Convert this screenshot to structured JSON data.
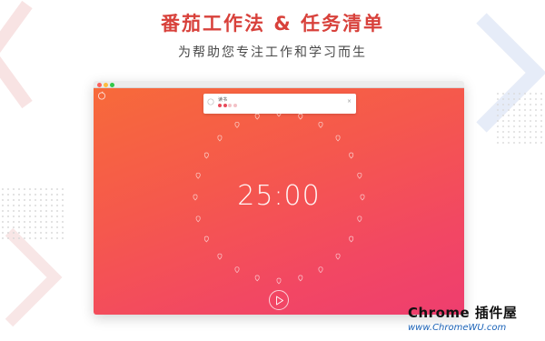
{
  "header": {
    "title": "番茄工作法 & 任务清单",
    "subtitle": "为帮助您专注工作和学习而生"
  },
  "window": {
    "controls": [
      "close",
      "minimize",
      "zoom"
    ]
  },
  "task": {
    "title": "读书",
    "pomodoro_total": 4,
    "pomodoro_done": 2,
    "close_label": "×",
    "icon": "clock-icon"
  },
  "timer": {
    "display": "25:00",
    "tick_count": 24
  },
  "colors": {
    "brand_red": "#d8413b",
    "gradient_start": "#f76a3a",
    "gradient_end": "#ee3e6f",
    "dot_done": "#e84a5a",
    "dot_todo": "#f3c2c7"
  },
  "watermark": {
    "line1": "Chrome 插件屋",
    "line2": "www.ChromeWU.com"
  }
}
